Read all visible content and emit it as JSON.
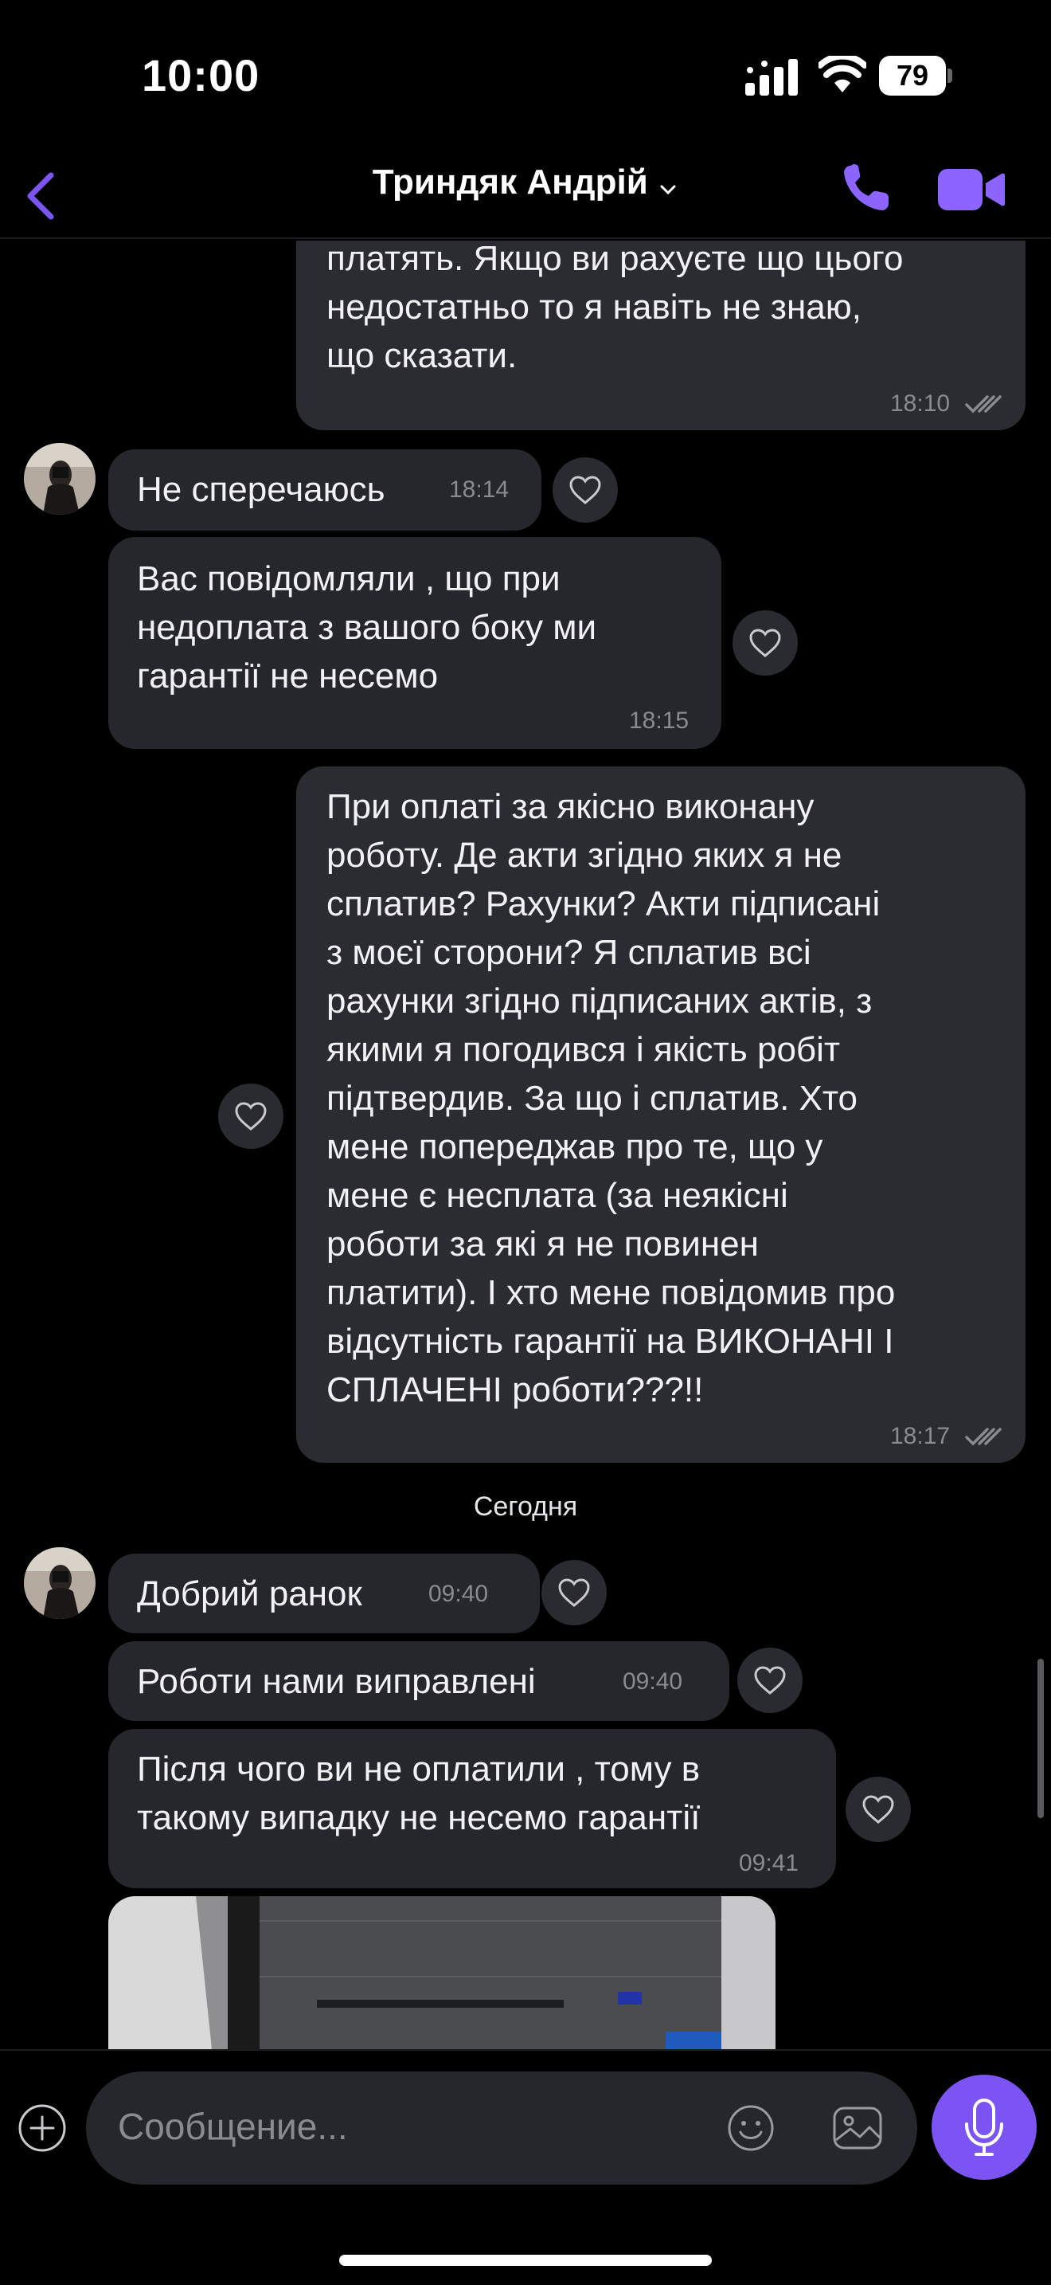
{
  "status_bar": {
    "time": "10:00",
    "battery": "79"
  },
  "header": {
    "contact_name": "Триндяк Андрій"
  },
  "colors": {
    "accent": "#7d54f4",
    "bubble": "#2b2c31",
    "background": "#000000"
  },
  "messages": [
    {
      "direction": "out",
      "lines": [
        "платять. Якщо ви рахуєте що цього",
        "недостатньо то я навіть не знаю,",
        "що сказати."
      ],
      "time": "18:10",
      "read": true
    },
    {
      "direction": "in",
      "lines": [
        "Не сперечаюсь"
      ],
      "time": "18:14"
    },
    {
      "direction": "in",
      "lines": [
        "Вас повідомляли , що при",
        "недоплата з вашого боку ми",
        "гарантії не несемо"
      ],
      "time": "18:15"
    },
    {
      "direction": "out",
      "lines": [
        "При оплаті за якісно виконану",
        "роботу. Де акти згідно яких я не",
        "сплатив? Рахунки?  Акти підписані",
        "з моєї сторони?  Я сплатив всі",
        "рахунки згідно підписаних актів, з",
        "якими я погодився і якість робіт",
        "підтвердив. За що і сплатив. Хто",
        "мене попереджав про те, що у",
        "мене є несплата (за неякісні",
        "роботи за які я не повинен",
        "платити). І хто мене повідомив про",
        "відсутність гарантії на ВИКОНАНІ І",
        "СПЛАЧЕНІ роботи???!!"
      ],
      "time": "18:17",
      "read": true
    },
    {
      "direction": "in",
      "lines": [
        "Добрий ранок"
      ],
      "time": "09:40"
    },
    {
      "direction": "in",
      "lines": [
        "Роботи нами виправлені"
      ],
      "time": "09:40"
    },
    {
      "direction": "in",
      "lines": [
        "Після чого ви не оплатили , тому в",
        "такому випадку не несемо гарантії"
      ],
      "time": "09:41"
    }
  ],
  "date_separator": "Сегодня",
  "composer": {
    "placeholder": "Сообщение..."
  },
  "icons": [
    "back-chevron-icon",
    "phone-icon",
    "video-camera-icon",
    "heart-icon",
    "read-ticks-icon",
    "arrow-down-icon",
    "plus-icon",
    "sticker-icon",
    "gallery-icon",
    "microphone-icon"
  ]
}
